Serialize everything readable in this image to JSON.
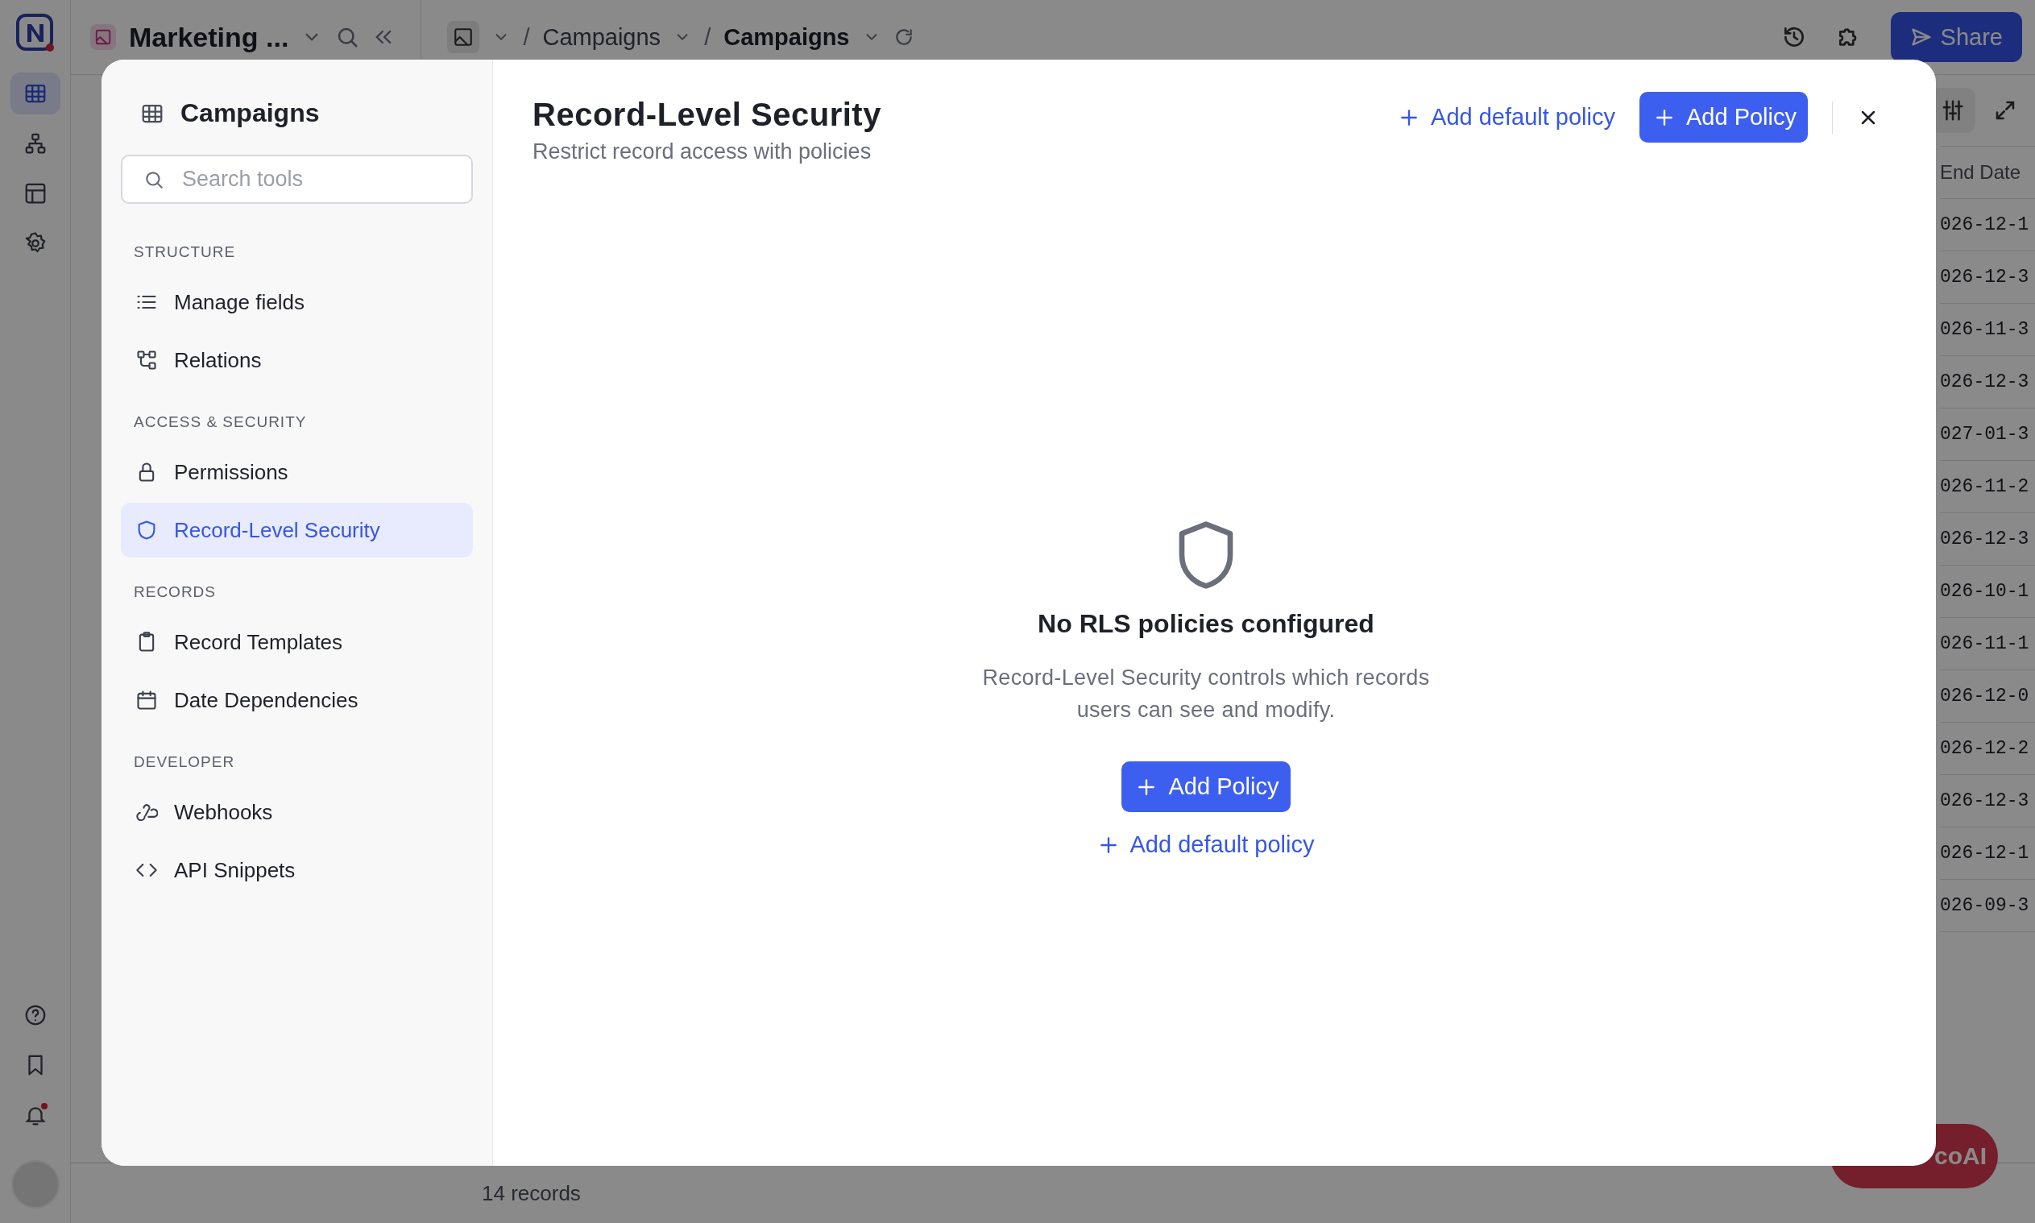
{
  "rail": {
    "items": [
      {
        "kind": "table",
        "selected": true
      },
      {
        "kind": "hierarchy",
        "selected": false
      },
      {
        "kind": "layout",
        "selected": false
      },
      {
        "kind": "settings",
        "selected": false
      }
    ],
    "notifications": {
      "unread": true
    }
  },
  "topbar": {
    "workspace": "Marketing ...",
    "breadcrumbs": [
      {
        "label": "Campaigns",
        "current": false
      },
      {
        "label": "Campaigns",
        "current": true
      }
    ],
    "separator": "/",
    "share": "Share"
  },
  "table": {
    "column": "End Date",
    "rows": [
      "026-12-1",
      "026-12-3",
      "026-11-3",
      "026-12-3",
      "027-01-3",
      "026-11-2",
      "026-12-3",
      "026-10-1",
      "026-11-1",
      "026-12-0",
      "026-12-2",
      "026-12-3",
      "026-12-1",
      "026-09-3"
    ]
  },
  "footer": {
    "count": "14 records"
  },
  "assistant": {
    "label": "coAI"
  },
  "modal": {
    "sidebar": {
      "title": "Campaigns",
      "search": {
        "placeholder": "Search tools"
      },
      "sections": [
        {
          "title": "STRUCTURE",
          "items": [
            {
              "label": "Manage fields",
              "kind": "list",
              "selected": false
            },
            {
              "label": "Relations",
              "kind": "relations",
              "selected": false
            }
          ]
        },
        {
          "title": "ACCESS & SECURITY",
          "items": [
            {
              "label": "Permissions",
              "kind": "lock",
              "selected": false
            },
            {
              "label": "Record-Level Security",
              "kind": "shield",
              "selected": true
            }
          ]
        },
        {
          "title": "RECORDS",
          "items": [
            {
              "label": "Record Templates",
              "kind": "clipboard",
              "selected": false
            },
            {
              "label": "Date Dependencies",
              "kind": "calendar",
              "selected": false
            }
          ]
        },
        {
          "title": "DEVELOPER",
          "items": [
            {
              "label": "Webhooks",
              "kind": "webhook",
              "selected": false
            },
            {
              "label": "API Snippets",
              "kind": "code",
              "selected": false
            }
          ]
        }
      ]
    },
    "title": "Record-Level Security",
    "subtitle": "Restrict record access with policies",
    "add_default": "Add default policy",
    "add_policy": "Add Policy",
    "empty": {
      "title": "No RLS policies configured",
      "description": "Record-Level Security controls which records users can see and modify.",
      "button": "Add Policy",
      "link": "Add default policy"
    }
  }
}
